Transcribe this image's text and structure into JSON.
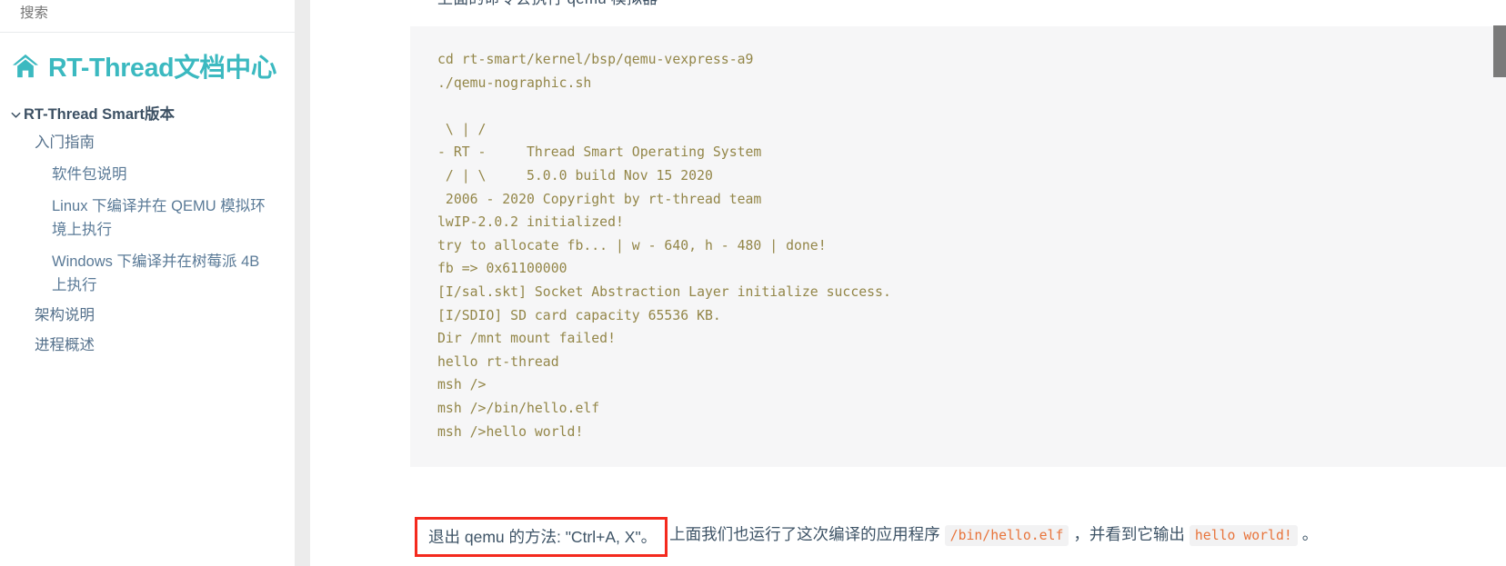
{
  "sidebar": {
    "search": {
      "placeholder": "搜索"
    },
    "brand": {
      "icon": "home-icon",
      "text": "RT-Thread文档中心",
      "color": "#3BB9C0"
    },
    "nav": {
      "root": {
        "label": "RT-Thread Smart版本",
        "expanded": true,
        "icon": "chevron-down-icon"
      },
      "items": [
        {
          "label": "入门指南",
          "level": 1
        },
        {
          "label": "软件包说明",
          "level": 2
        },
        {
          "label": "Linux 下编译并在 QEMU 模拟环境上执行",
          "level": 2
        },
        {
          "label": "Windows 下编译并在树莓派 4B 上执行",
          "level": 2
        },
        {
          "label": "架构说明",
          "level": 1
        },
        {
          "label": "进程概述",
          "level": 1
        }
      ]
    }
  },
  "main": {
    "clipped_heading": "上面的命令会执行 qemu 模拟器",
    "code_block": {
      "language": "shell-output",
      "text_color": "#938648",
      "background": "#f6f6f7",
      "lines": [
        "cd rt-smart/kernel/bsp/qemu-vexpress-a9",
        "./qemu-nographic.sh",
        "",
        " \\ | /",
        "- RT -     Thread Smart Operating System",
        " / | \\     5.0.0 build Nov 15 2020",
        " 2006 - 2020 Copyright by rt-thread team",
        "lwIP-2.0.2 initialized!",
        "try to allocate fb... | w - 640, h - 480 | done!",
        "fb => 0x61100000",
        "[I/sal.skt] Socket Abstraction Layer initialize success.",
        "[I/SDIO] SD card capacity 65536 KB.",
        "Dir /mnt mount failed!",
        "hello rt-thread",
        "msh />",
        "msh />/bin/hello.elf",
        "msh />hello world!"
      ]
    },
    "paragraph": {
      "highlighted_text": "退出 qemu 的方法: \"Ctrl+A, X\"。",
      "highlight_border_color": "#f42a1e",
      "rest_1": "上面我们也运行了这次编译的应用程序",
      "inline_code_1": "/bin/hello.elf",
      "rest_2": "，并看到它输出",
      "inline_code_2": "hello world!",
      "rest_3": "。",
      "inline_code_color": "#e8743b"
    }
  },
  "scrollbar": {
    "orientation": "vertical",
    "thumb_color": "#7a7a7a",
    "position_percent": 5
  }
}
